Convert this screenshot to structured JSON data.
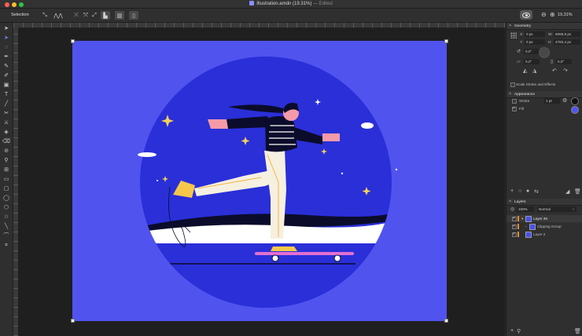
{
  "window": {
    "title": "Illustration.amdn (19.31%)",
    "separator": "—",
    "status": "Edited"
  },
  "toolbar": {
    "mode_label": "Selection",
    "zoom_label": "19,31%"
  },
  "geometry": {
    "panel_title": "Geometry",
    "x_label": "X:",
    "x_value": "0 px",
    "y_label": "Y:",
    "y_value": "0 px",
    "w_label": "W:",
    "w_value": "6069,8 px",
    "h_label": "H:",
    "h_value": "4782,4 px",
    "rotation_value": "0,0°",
    "shear_value": "0,0°",
    "corner_value": "0,0°",
    "scale_stroke_label": "Scale Stroke and Effects"
  },
  "appearance": {
    "panel_title": "Appearance",
    "stroke_label": "Stroke",
    "stroke_value": "1 pt",
    "fill_label": "Fill",
    "fill_color": "#4f55f0"
  },
  "layers": {
    "panel_title": "Layers",
    "opacity_value": "100%",
    "blend_mode": "Normal",
    "items": [
      {
        "name": "Layer 39"
      },
      {
        "name": "Clipping Group"
      },
      {
        "name": "Layer 2"
      }
    ]
  },
  "colors": {
    "artboard": "#5153ef",
    "circle": "#2a2fd8",
    "accent": "#f08a2a"
  }
}
